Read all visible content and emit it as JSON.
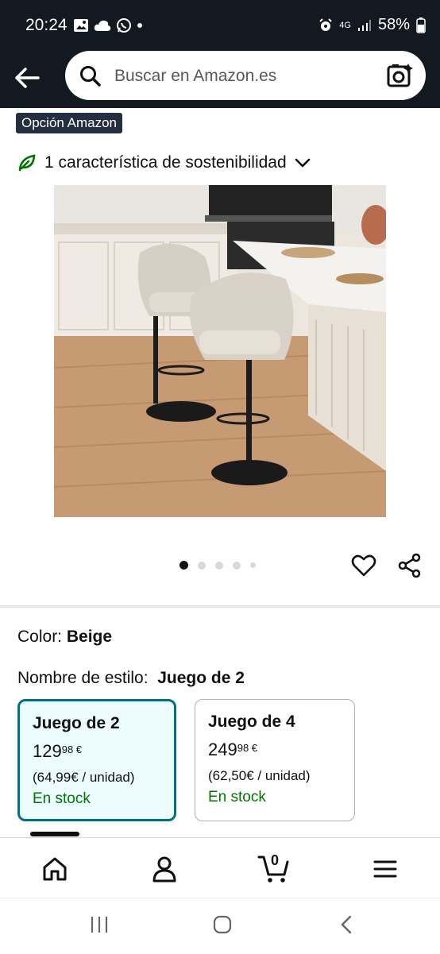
{
  "status": {
    "time": "20:24",
    "network": "4G",
    "battery": "58%"
  },
  "search": {
    "placeholder": "Buscar en Amazon.es"
  },
  "badge": "Opción Amazon",
  "sustainability": {
    "text": "1 característica de sostenibilidad"
  },
  "gallery": {
    "total_images": 5,
    "active_index": 0
  },
  "color": {
    "label": "Color:",
    "value": "Beige"
  },
  "style": {
    "label": "Nombre de estilo:",
    "value": "Juego de 2"
  },
  "options": [
    {
      "title": "Juego de 2",
      "price_whole": "129",
      "price_fraction": "98 €",
      "unit": "(64,99€ / unidad)",
      "stock": "En stock",
      "selected": true
    },
    {
      "title": "Juego de 4",
      "price_whole": "249",
      "price_fraction": "98 €",
      "unit": "(62,50€ / unidad)",
      "stock": "En stock",
      "selected": false
    }
  ],
  "bottom_nav": {
    "cart_count": "0",
    "items": [
      "home-icon",
      "account-icon",
      "cart-icon",
      "menu-icon"
    ]
  },
  "colors": {
    "header": "#131921",
    "selected_border": "#007185",
    "stock": "#007600"
  }
}
